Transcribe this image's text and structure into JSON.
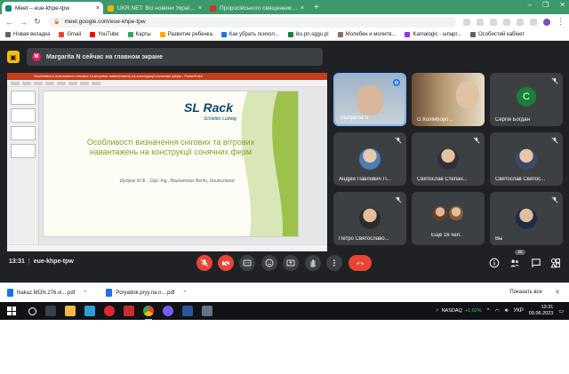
{
  "browser": {
    "tabs": [
      {
        "title": "Meet – eue-khpe-tpw",
        "active": true,
        "favicon_color": "#00897b"
      },
      {
        "title": "UKR.NET: Всі новини України, ос",
        "active": false,
        "favicon_color": "#f4b400"
      },
      {
        "title": "Проросійського священника за",
        "active": false,
        "favicon_color": "#d93025"
      }
    ],
    "new_tab_label": "+",
    "url": "meet.google.com/eue-khpe-tpw",
    "bookmarks": [
      {
        "label": "Новая вкладка",
        "color": "#5f6368"
      },
      {
        "label": "Gmail",
        "color": "#ea4335"
      },
      {
        "label": "YouTube",
        "color": "#ff0000"
      },
      {
        "label": "Карты",
        "color": "#34a853"
      },
      {
        "label": "Развитие ребенка",
        "color": "#f9ab00"
      },
      {
        "label": "Как убрать психол...",
        "color": "#1a73e8"
      },
      {
        "label": "iks.pn.sggu.pl",
        "color": "#188038"
      },
      {
        "label": "Молебен и молитв...",
        "color": "#8d6e63"
      },
      {
        "label": "Kamalogic - шпарг...",
        "color": "#9334e6"
      },
      {
        "label": "Особистий кабінет",
        "color": "#5f6368"
      }
    ]
  },
  "meet": {
    "presenting_notice": "Margarita N сейчас на главном экране",
    "presenter_initial": "M",
    "meeting_time": "13:31",
    "meeting_code": "eue-khpe-tpw",
    "participant_count": "25",
    "participants": [
      {
        "name": "Margarita N",
        "type": "video",
        "speaking": true
      },
      {
        "name": "О.Колімборо...",
        "type": "video",
        "speaking": false
      },
      {
        "name": "Сергій Богдан",
        "type": "initial",
        "initial": "С",
        "speaking": false
      },
      {
        "name": "Андрій Павлович П...",
        "type": "photo",
        "speaking": false
      },
      {
        "name": "Святослав Степан...",
        "type": "photo",
        "speaking": false
      },
      {
        "name": "Святослав Святос...",
        "type": "photo",
        "speaking": false
      },
      {
        "name": "Петро Святославо...",
        "type": "photo",
        "speaking": false
      },
      {
        "name": "Ещё 16 чел.",
        "type": "group",
        "speaking": false
      },
      {
        "name": "Вы",
        "type": "photo",
        "speaking": false
      }
    ],
    "slide": {
      "window_title": "Особливості визначення снігових та вітрових навантажень на конструкції сонячних ферм - PowerPoint",
      "logo_main": "SL Rack",
      "logo_sub": "Schletter Ludwig",
      "title": "Особливості визначення снігових та вітрових навантажень на конструкції сонячних ферм",
      "author": "Шудрик М.Ф. , Dipl.-Ing., Baukammer Berlin, Deutschland"
    }
  },
  "downloads": {
    "items": [
      "Nakaz.MON.276.vi....pdf",
      "Poryadok.pryy.na.n....pdf"
    ],
    "show_all": "Показать все"
  },
  "taskbar": {
    "ticker_name": "NASDAQ",
    "ticker_change": "+1,02%",
    "lang": "УКР",
    "time": "13:31",
    "date": "09.06.2023"
  },
  "colors": {
    "accent_green": "#3c9a6a",
    "meet_bg": "#202124",
    "end_call": "#ea4335",
    "slide_title": "#7ca52b"
  }
}
